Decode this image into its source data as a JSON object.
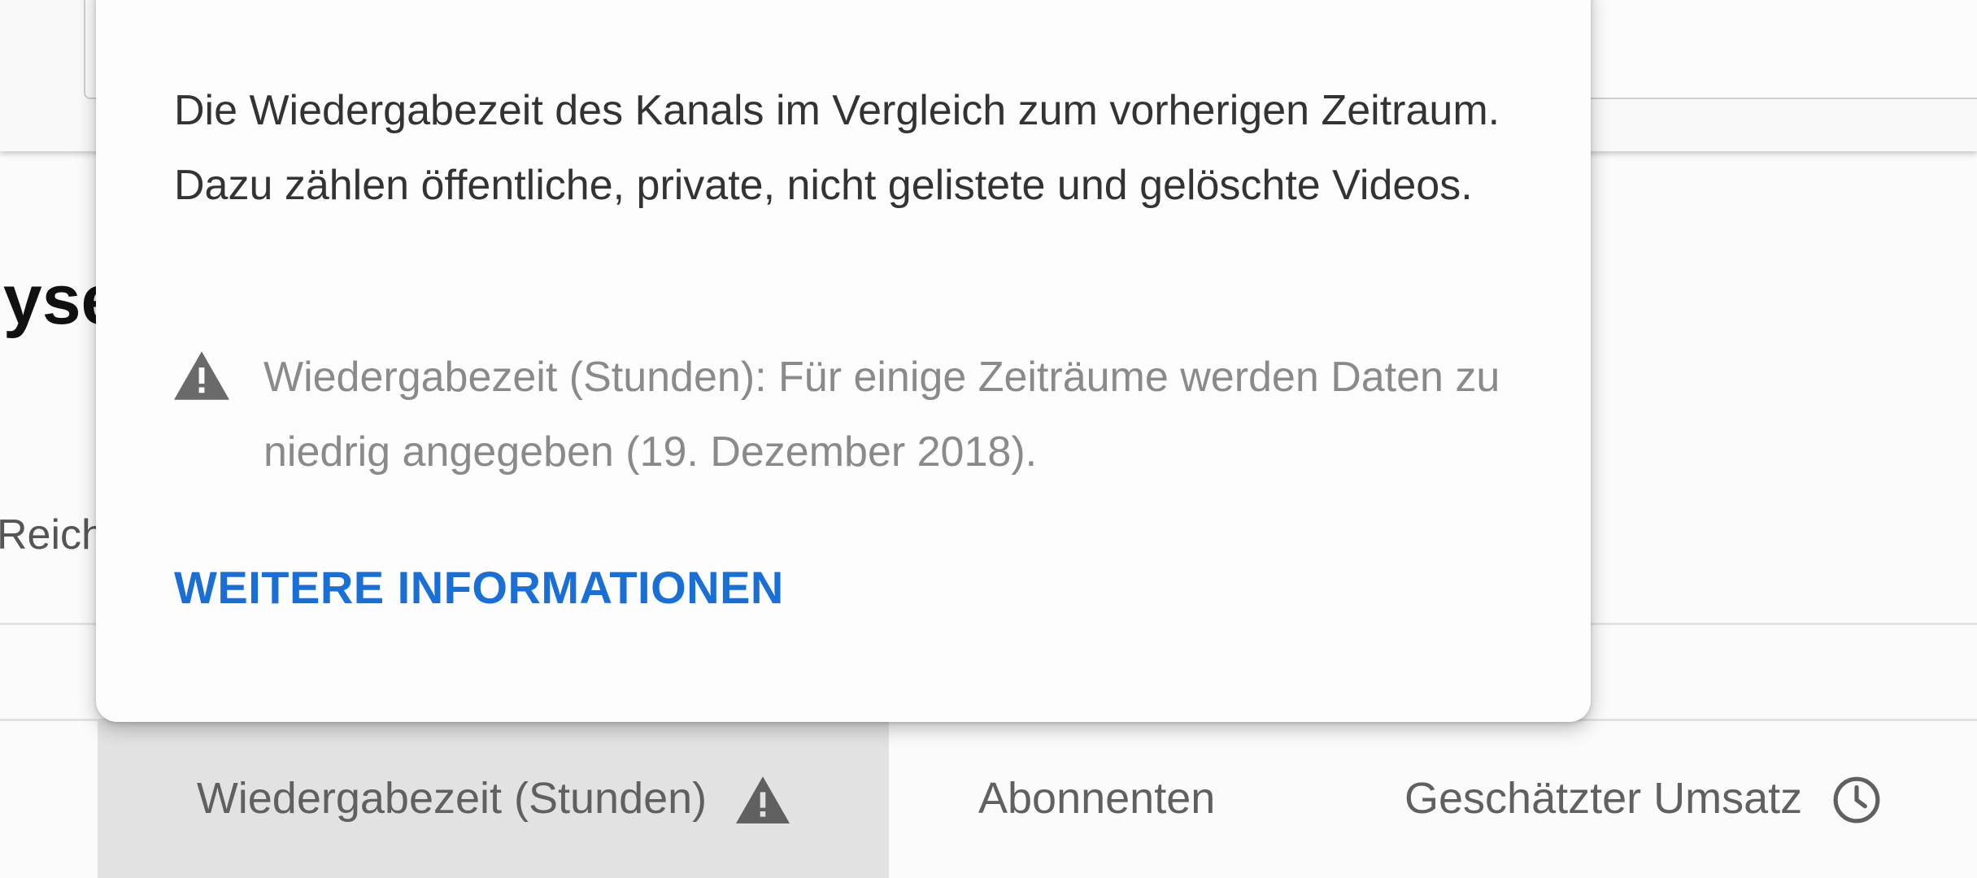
{
  "page": {
    "heading_fragment": "lyse",
    "left_tab_fragment": "Reich"
  },
  "tooltip": {
    "description": "Die Wiedergabezeit des Kanals im Vergleich zum vorherigen Zeitraum. Dazu zählen öffentliche, private, nicht gelistete und gelöschte Videos.",
    "warning_icon": "warning-triangle-icon",
    "warning_text": "Wiedergabezeit (Stunden): Für einige Zeiträume werden Daten zu niedrig angegeben (19. Dezember 2018).",
    "learn_more_label": "WEITERE INFORMATIONEN"
  },
  "metric_tabs": [
    {
      "label": "Wiedergabezeit (Stunden)",
      "icon": "warning-triangle-icon",
      "selected": true
    },
    {
      "label": "Abonnenten",
      "icon": "",
      "selected": false
    },
    {
      "label": "Geschätzter Umsatz",
      "icon": "clock-icon",
      "selected": false
    }
  ],
  "colors": {
    "link": "#1a6fd6",
    "selected_tab_bg": "#e2e2e2",
    "warning_text": "#8a8a8a",
    "icon": "#606060"
  }
}
